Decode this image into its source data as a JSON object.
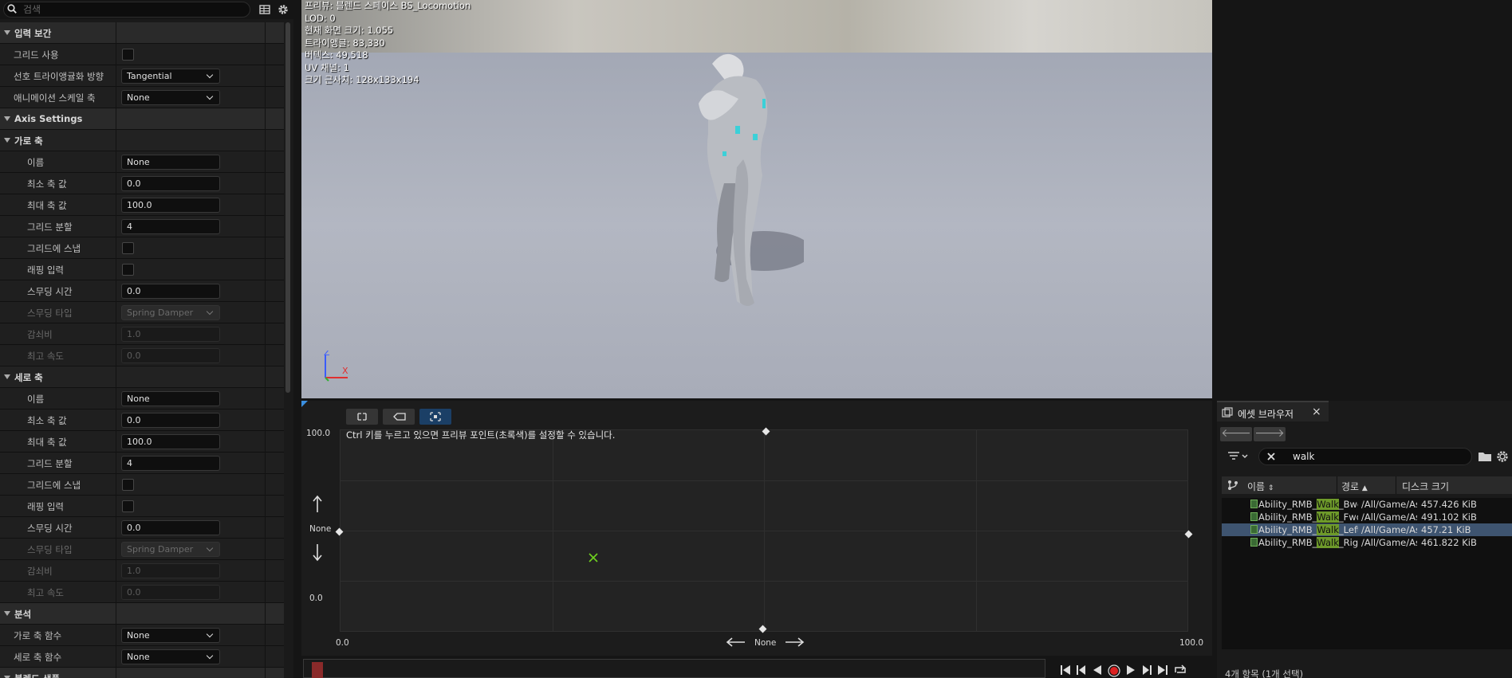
{
  "details": {
    "search_placeholder": "검색",
    "categories": {
      "input_interp": "입력 보간",
      "axis_settings": "Axis Settings",
      "horizontal_axis": "가로 축",
      "vertical_axis": "세로 축",
      "analysis": "분석",
      "blend_samples": "블렌드 샘플"
    },
    "input_interp_rows": [
      {
        "label": "그리드 사용",
        "type": "checkbox",
        "checked": false
      },
      {
        "label": "선호 트라이앵귤화 방향",
        "type": "dropdown",
        "value": "Tangential"
      },
      {
        "label": "애니메이션 스케일 축",
        "type": "dropdown",
        "value": "None"
      }
    ],
    "horizontal_axis_rows": [
      {
        "label": "이름",
        "type": "text",
        "value": "None"
      },
      {
        "label": "최소 축 값",
        "type": "text",
        "value": "0.0"
      },
      {
        "label": "최대 축 값",
        "type": "text",
        "value": "100.0"
      },
      {
        "label": "그리드 분할",
        "type": "text",
        "value": "4"
      },
      {
        "label": "그리드에 스냅",
        "type": "checkbox",
        "checked": false
      },
      {
        "label": "래핑 입력",
        "type": "checkbox",
        "checked": false
      },
      {
        "label": "스무딩 시간",
        "type": "text",
        "value": "0.0"
      },
      {
        "label": "스무딩 타입",
        "type": "dropdown",
        "value": "Spring Damper",
        "disabled": true
      },
      {
        "label": "감쇠비",
        "type": "text",
        "value": "1.0",
        "disabled": true
      },
      {
        "label": "최고 속도",
        "type": "text",
        "value": "0.0",
        "disabled": true
      }
    ],
    "vertical_axis_rows": [
      {
        "label": "이름",
        "type": "text",
        "value": "None"
      },
      {
        "label": "최소 축 값",
        "type": "text",
        "value": "0.0"
      },
      {
        "label": "최대 축 값",
        "type": "text",
        "value": "100.0"
      },
      {
        "label": "그리드 분할",
        "type": "text",
        "value": "4"
      },
      {
        "label": "그리드에 스냅",
        "type": "checkbox",
        "checked": false
      },
      {
        "label": "래핑 입력",
        "type": "checkbox",
        "checked": false
      },
      {
        "label": "스무딩 시간",
        "type": "text",
        "value": "0.0"
      },
      {
        "label": "스무딩 타입",
        "type": "dropdown",
        "value": "Spring Damper",
        "disabled": true
      },
      {
        "label": "감쇠비",
        "type": "text",
        "value": "1.0",
        "disabled": true
      },
      {
        "label": "최고 속도",
        "type": "text",
        "value": "0.0",
        "disabled": true
      }
    ],
    "analysis_rows": [
      {
        "label": "가로 축 함수",
        "type": "dropdown",
        "value": "None"
      },
      {
        "label": "세로 축 함수",
        "type": "dropdown",
        "value": "None"
      }
    ]
  },
  "viewport": {
    "stats": [
      "프리뷰: 블렌드 스페이스 BS_Locomotion",
      "LOD: 0",
      "현재 화면 크기: 1.055",
      "트라이앵글: 83,330",
      "버텍스: 49,518",
      "UV 채널: 1",
      "크기 근사치: 128x133x194"
    ],
    "axis_z": "Z",
    "axis_x": "X"
  },
  "blendspace": {
    "hint": "Ctrl 키를 누르고 있으면 프리뷰 포인트(초록색)를 설정할 수 있습니다.",
    "y_max": "100.0",
    "y_min": "0.0",
    "y_name": "None",
    "x_min": "0.0",
    "x_max": "100.0",
    "x_name": "None",
    "grid_divisions": 4
  },
  "asset_browser": {
    "title": "에셋 브라우저",
    "search_value": "walk",
    "columns": {
      "name": "이름",
      "path": "경로",
      "size": "디스크 크기"
    },
    "items": [
      {
        "pre": "Ability_RMB_",
        "hl": "Walk",
        "post": "_Bwd",
        "path": "/All/Game/As",
        "size": "457.426 KiB",
        "selected": false
      },
      {
        "pre": "Ability_RMB_",
        "hl": "Walk",
        "post": "_Fwd",
        "path": "/All/Game/As",
        "size": "491.102 KiB",
        "selected": false
      },
      {
        "pre": "Ability_RMB_",
        "hl": "Walk",
        "post": "_Left",
        "path": "/All/Game/As",
        "size": "457.21 KiB",
        "selected": true
      },
      {
        "pre": "Ability_RMB_",
        "hl": "Walk",
        "post": "_Righ",
        "path": "/All/Game/As",
        "size": "461.822 KiB",
        "selected": false
      }
    ],
    "status": "4개 항목 (1개 선택)"
  }
}
